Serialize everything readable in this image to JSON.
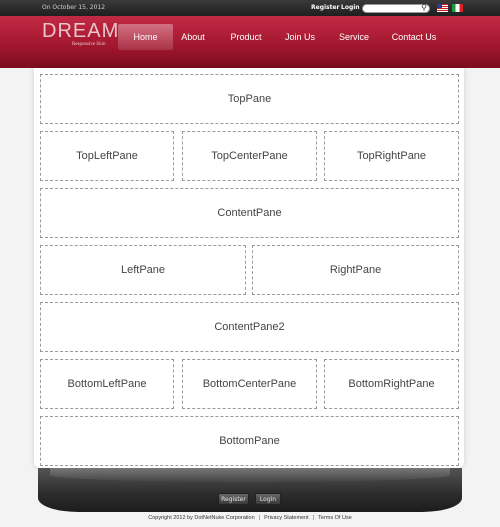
{
  "topbar": {
    "date": "On October 15, 2012",
    "register": "Register",
    "login": "Login",
    "search_placeholder": ""
  },
  "header": {
    "logo": "DREAM",
    "logo_sub": "Responsive Skin",
    "nav": [
      "Home",
      "About",
      "Product",
      "Join Us",
      "Service",
      "Contact Us"
    ],
    "active": "Home"
  },
  "panes": {
    "top": "TopPane",
    "top_left": "TopLeftPane",
    "top_center": "TopCenterPane",
    "top_right": "TopRightPane",
    "content": "ContentPane",
    "left": "LeftPane",
    "right": "RightPane",
    "content2": "ContentPane2",
    "bottom_left": "BottomLeftPane",
    "bottom_center": "BottomCenterPane",
    "bottom_right": "BottomRightPane",
    "bottom": "BottomPane"
  },
  "footer": {
    "register": "Register",
    "login": "Login",
    "copyright": "Copyright 2012 by DotNetNuke Corporation",
    "privacy": "Privacy Statement",
    "terms": "Terms Of Use"
  },
  "colors": {
    "header": "#a4172f",
    "topbar": "#2a2a2a",
    "footer": "#2e2e2e"
  }
}
